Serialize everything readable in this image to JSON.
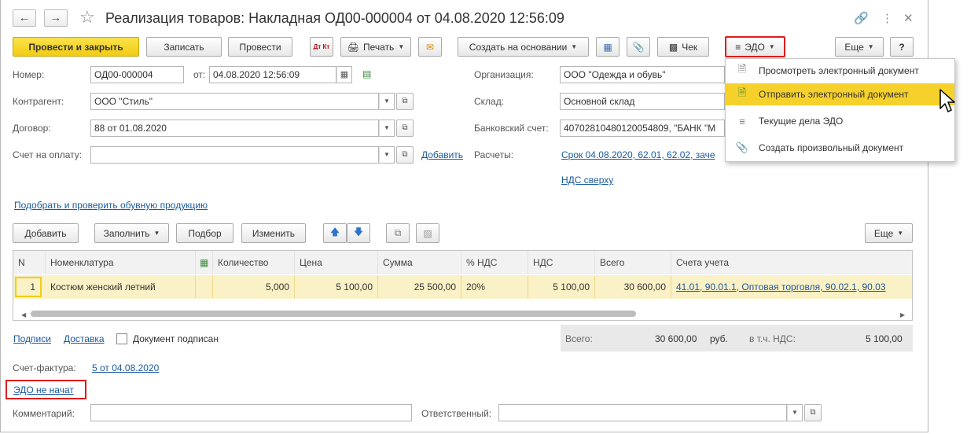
{
  "header": {
    "title": "Реализация товаров: Накладная ОД00-000004 от 04.08.2020 12:56:09"
  },
  "toolbar": {
    "post_close": "Провести и закрыть",
    "save": "Записать",
    "post": "Провести",
    "dtkt": "Дт Кт",
    "print": "Печать",
    "create_based": "Создать на основании",
    "check": "Чек",
    "edo": "ЭДО",
    "more": "Еще",
    "help": "?"
  },
  "edo_menu": {
    "items": [
      {
        "label": "Просмотреть электронный документ",
        "icon": "document-icon",
        "highlighted": false
      },
      {
        "label": "Отправить электронный документ",
        "icon": "send-document-icon",
        "highlighted": true
      },
      {
        "label": "Текущие дела ЭДО",
        "icon": "tasks-icon",
        "highlighted": false
      },
      {
        "label": "Создать произвольный документ",
        "icon": "paperclip-icon",
        "highlighted": false
      }
    ]
  },
  "form": {
    "number_label": "Номер:",
    "number": "ОД00-000004",
    "date_label": "от:",
    "date": "04.08.2020 12:56:09",
    "counterparty_label": "Контрагент:",
    "counterparty": "ООО \"Стиль\"",
    "contract_label": "Договор:",
    "contract": "88 от 01.08.2020",
    "invoice_label": "Счет на оплату:",
    "invoice": "",
    "add_link": "Добавить",
    "org_label": "Организация:",
    "org": "ООО \"Одежда и обувь\"",
    "warehouse_label": "Склад:",
    "warehouse": "Основной склад",
    "bank_label": "Банковский счет:",
    "bank": "40702810480120054809, \"БАНК \"М",
    "settlements_label": "Расчеты:",
    "settlements": "Срок 04.08.2020, 62.01, 62.02, заче",
    "vat_link": "НДС сверху",
    "shoes_link": "Подобрать и проверить обувную продукцию"
  },
  "table_toolbar": {
    "add": "Добавить",
    "fill": "Заполнить",
    "pick": "Подбор",
    "change": "Изменить",
    "more": "Еще"
  },
  "table": {
    "columns": [
      "N",
      "Номенклатура",
      "Количество",
      "Цена",
      "Сумма",
      "% НДС",
      "НДС",
      "Всего",
      "Счета учета"
    ],
    "rows": [
      {
        "n": "1",
        "name": "Костюм женский летний",
        "qty": "5,000",
        "price": "5 100,00",
        "sum": "25 500,00",
        "vat_rate": "20%",
        "vat": "5 100,00",
        "total": "30 600,00",
        "accounts": "41.01, 90.01.1, Оптовая торговля, 90.02.1, 90.03"
      }
    ]
  },
  "footer": {
    "signatures_link": "Подписи",
    "delivery_link": "Доставка",
    "signed_label": "Документ подписан",
    "total_label": "Всего:",
    "total_value": "30 600,00",
    "currency": "руб.",
    "vat_incl_label": "в т.ч. НДС:",
    "vat_value": "5 100,00",
    "invoice_label": "Счет-фактура:",
    "invoice_link": "5 от 04.08.2020",
    "edo_status": "ЭДО не начат",
    "comment_label": "Комментарий:",
    "comment": "",
    "responsible_label": "Ответственный:",
    "responsible": ""
  }
}
